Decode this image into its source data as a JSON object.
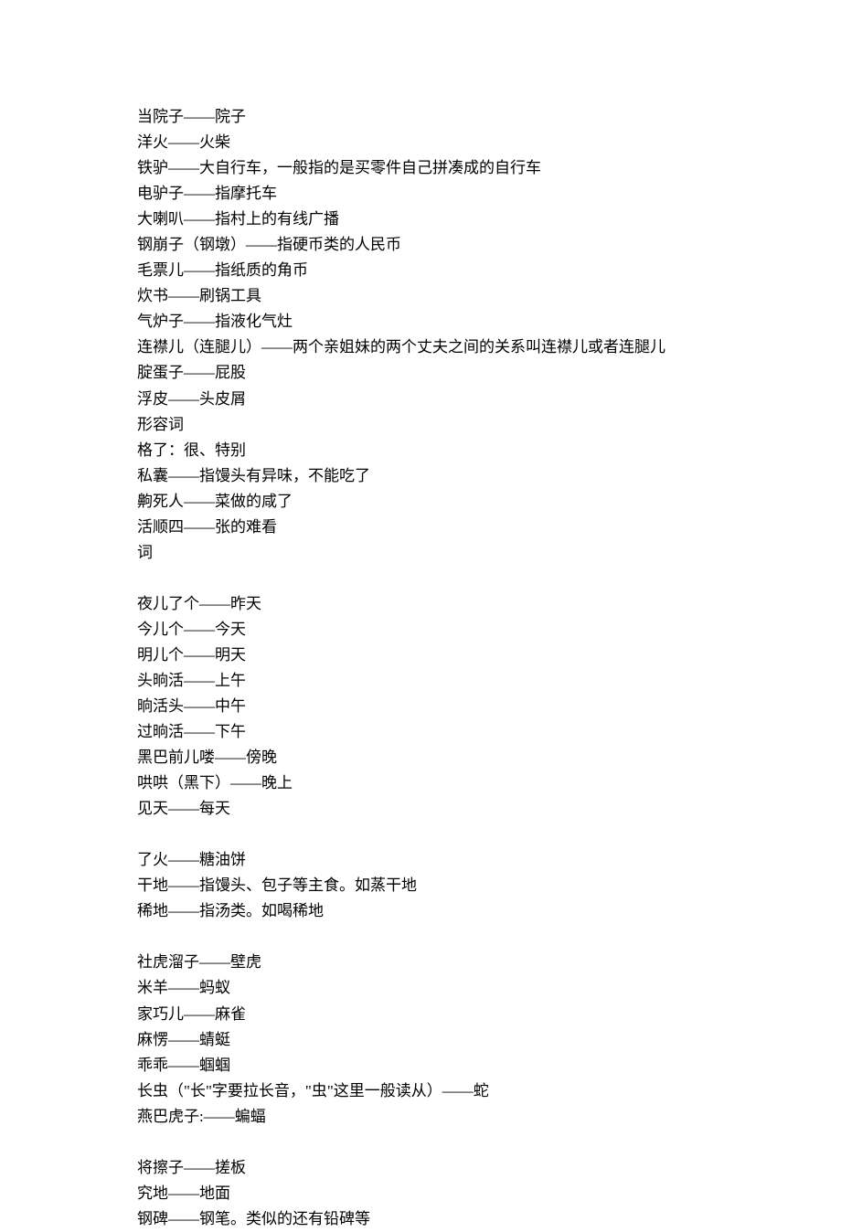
{
  "lines": [
    "当院子——院子",
    "洋火——火柴",
    "铁驴——大自行车，一般指的是买零件自己拼凑成的自行车",
    "电驴子——指摩托车",
    "大喇叭——指村上的有线广播",
    "钢崩子（钢墩）——指硬币类的人民币",
    "毛票儿——指纸质的角币",
    "炊书——刷锅工具",
    "气炉子——指液化气灶",
    "连襟儿（连腿儿）——两个亲姐妹的两个丈夫之间的关系叫连襟儿或者连腿儿",
    "腚蛋子——屁股",
    "浮皮——头皮屑",
    "形容词",
    "格了：很、特别",
    "私囊——指馒头有异味，不能吃了",
    "齁死人——菜做的咸了",
    "活顺四——张的难看",
    "词",
    "",
    "夜儿了个——昨天",
    "今儿个——今天",
    "明儿个——明天",
    "头晌活——上午",
    "晌活头——中午",
    "过晌活——下午",
    "黑巴前儿喽——傍晚",
    "哄哄（黑下）——晚上",
    "见天——每天",
    "",
    "了火——糖油饼",
    "干地——指馒头、包子等主食。如蒸干地",
    "稀地——指汤类。如喝稀地",
    "",
    "社虎溜子——壁虎",
    "米羊——蚂蚁",
    "家巧儿——麻雀",
    "麻愣——蜻蜓",
    "乖乖——蝈蝈",
    "长虫（\"长\"字要拉长音，\"虫\"这里一般读从）——蛇",
    "燕巴虎子:——蝙蝠",
    "",
    "将擦子——搓板",
    "究地——地面",
    "钢碑——钢笔。类似的还有铅碑等"
  ]
}
